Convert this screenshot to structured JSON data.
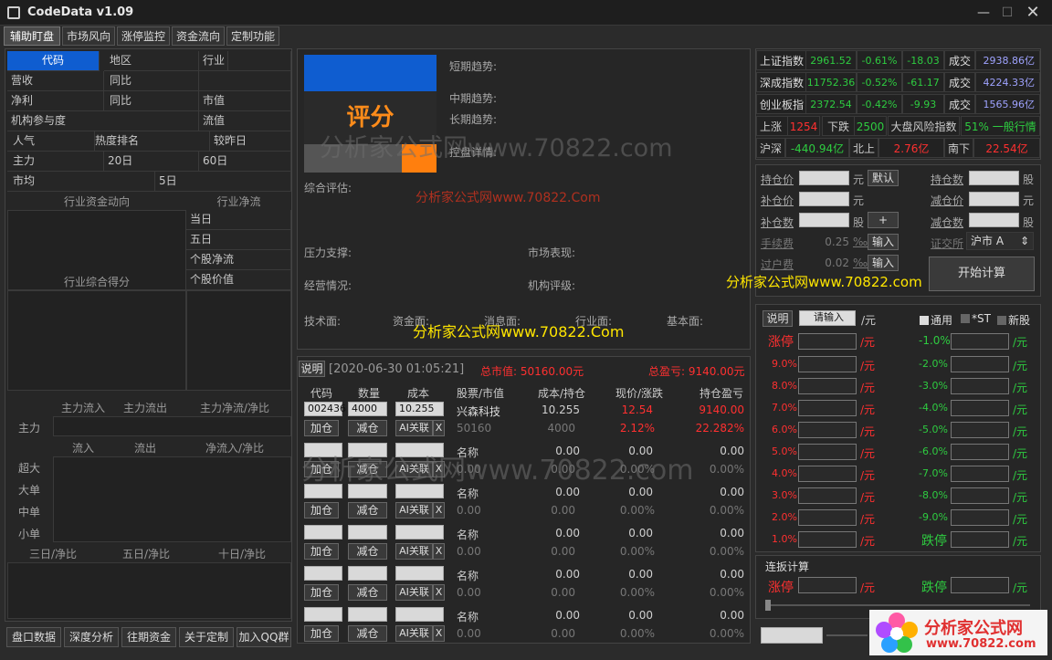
{
  "app": {
    "title": "CodeData v1.09"
  },
  "tabs": [
    "辅助盯盘",
    "市场风向",
    "涨停监控",
    "资金流向",
    "定制功能"
  ],
  "left": {
    "r1": [
      "代码",
      "地区",
      "行业"
    ],
    "r2": [
      "营收",
      "同比"
    ],
    "r3": [
      "净利",
      "同比",
      "市值"
    ],
    "r4": [
      "机构参与度",
      "流值"
    ],
    "r5": [
      "人气",
      "热度排名",
      "较昨日"
    ],
    "r6": [
      "主力",
      "20日",
      "60日"
    ],
    "r7": [
      "市均",
      "5日"
    ],
    "fund_hdr": [
      "行业资金动向",
      "行业净流"
    ],
    "fund_side": [
      "当日",
      "五日",
      "个股净流",
      "个股价值"
    ],
    "score_hdr": "行业综合得分",
    "flow_hdr1": [
      "主力流入",
      "主力流出",
      "主力净流/净比"
    ],
    "flow_main": "主力",
    "flow_hdr2": [
      "流入",
      "流出",
      "净流入/净比"
    ],
    "flow_rows": [
      "超大",
      "大单",
      "中单",
      "小单"
    ],
    "period_hdr": [
      "三日/净比",
      "五日/净比",
      "十日/净比"
    ]
  },
  "bottom_buttons": [
    "盘口数据",
    "深度分析",
    "往期资金",
    "关于定制",
    "加入QQ群"
  ],
  "center": {
    "score": "评分",
    "trend": [
      "短期趋势:",
      "中期趋势:",
      "长期趋势:",
      "控盘详情:"
    ],
    "overall": "综合评估:",
    "support": "压力支撑:",
    "market": "市场表现:",
    "ops": "经营情况:",
    "rating": "机构评级:",
    "tech": "技术面:",
    "capital": "资金面:",
    "market_face": "消息面:",
    "industry": "行业面:",
    "fundamental": "基本面:"
  },
  "trade": {
    "desc": "说明",
    "date": "[2020-06-30 01:05:21]",
    "total_mv": "总市值: 50160.00元",
    "total_pl": "总盈亏: 9140.00元",
    "headers": [
      "代码",
      "数量",
      "成本",
      "股票/市值",
      "成本/持仓",
      "现价/涨跌",
      "持仓盈亏"
    ],
    "btn_add": "加仓",
    "btn_sub": "减仓",
    "btn_ai": "AI关联",
    "btn_x": "X",
    "rows": [
      {
        "code": "002436",
        "qty": "4000",
        "cost": "10.255",
        "name": "兴森科技",
        "mv": "50160",
        "c1": "10.255",
        "c2": "4000",
        "p1": "12.54",
        "p2": "2.12%",
        "pl1": "9140.00",
        "pl2": "22.282%"
      },
      {
        "code": "",
        "qty": "",
        "cost": "",
        "name": "名称",
        "mv": "0.00",
        "c1": "0.00",
        "c2": "0.00",
        "p1": "0.00",
        "p2": "0.00%",
        "pl1": "0.00",
        "pl2": "0.00%"
      },
      {
        "code": "",
        "qty": "",
        "cost": "",
        "name": "名称",
        "mv": "0.00",
        "c1": "0.00",
        "c2": "0.00",
        "p1": "0.00",
        "p2": "0.00%",
        "pl1": "0.00",
        "pl2": "0.00%"
      },
      {
        "code": "",
        "qty": "",
        "cost": "",
        "name": "名称",
        "mv": "0.00",
        "c1": "0.00",
        "c2": "0.00",
        "p1": "0.00",
        "p2": "0.00%",
        "pl1": "0.00",
        "pl2": "0.00%"
      },
      {
        "code": "",
        "qty": "",
        "cost": "",
        "name": "名称",
        "mv": "0.00",
        "c1": "0.00",
        "c2": "0.00",
        "p1": "0.00",
        "p2": "0.00%",
        "pl1": "0.00",
        "pl2": "0.00%"
      },
      {
        "code": "",
        "qty": "",
        "cost": "",
        "name": "名称",
        "mv": "0.00",
        "c1": "0.00",
        "c2": "0.00",
        "p1": "0.00",
        "p2": "0.00%",
        "pl1": "0.00",
        "pl2": "0.00%"
      }
    ]
  },
  "market": {
    "indices": [
      {
        "name": "上证指数",
        "val": "2961.52",
        "pct": "-0.61%",
        "chg": "-18.03",
        "lbl": "成交",
        "amt": "2938.86亿"
      },
      {
        "name": "深成指数",
        "val": "11752.36",
        "pct": "-0.52%",
        "chg": "-61.17",
        "lbl": "成交",
        "amt": "4224.33亿"
      },
      {
        "name": "创业板指",
        "val": "2372.54",
        "pct": "-0.42%",
        "chg": "-9.93",
        "lbl": "成交",
        "amt": "1565.96亿"
      }
    ],
    "up_lbl": "上涨",
    "up": "1254",
    "down_lbl": "下跌",
    "down": "2500",
    "risk_lbl": "大盘风险指数",
    "risk": "51% 一般行情",
    "hs_lbl": "沪深",
    "hs": "-440.94亿",
    "north_lbl": "北上",
    "north": "2.76亿",
    "south_lbl": "南下",
    "south": "22.54亿"
  },
  "calc": {
    "hold_price": "持仓价",
    "unit_yuan": "元",
    "default_btn": "默认",
    "hold_qty": "持仓数",
    "unit_gu": "股",
    "add_price": "补仓价",
    "reduce_price": "减仓价",
    "add_qty": "补仓数",
    "plus_btn": "+",
    "reduce_qty": "减仓数",
    "fee": "手续费",
    "fee_val": "0.25",
    "permil": "‰",
    "input_btn": "输入",
    "exchange": "证交所",
    "exchange_val": "沪市 A",
    "transfer": "过户费",
    "transfer_val": "0.02",
    "start_btn": "开始计算"
  },
  "limit": {
    "desc": "说明",
    "input": "请输入",
    "per": "/元",
    "opt1": "通用",
    "opt2": "*ST",
    "opt3": "新股",
    "up_lbl": "涨停",
    "down_lbl": "跌停",
    "ups": [
      "9.0%",
      "8.0%",
      "7.0%",
      "6.0%",
      "5.0%",
      "4.0%",
      "3.0%",
      "2.0%",
      "1.0%"
    ],
    "downs": [
      "-1.0%",
      "-2.0%",
      "-3.0%",
      "-4.0%",
      "-5.0%",
      "-6.0%",
      "-7.0%",
      "-8.0%",
      "-9.0%"
    ]
  },
  "serial": {
    "title": "连扳计算",
    "up": "涨停",
    "down": "跌停",
    "per": "/元"
  },
  "watermarks": [
    "分析家公式网www.70822.com",
    "分析家公式网www.70822.Com",
    "分析家公式网www.70822.com",
    "分析家公式网www.70822.Com",
    "分析家公式网www.70822.com"
  ],
  "logo": {
    "name": "分析家公式网",
    "url": "www.70822.com"
  },
  "colors": {
    "accent": "#0f5dd0",
    "score": "#ff8c1a",
    "up": "#ff3030",
    "down": "#2ecc40"
  }
}
